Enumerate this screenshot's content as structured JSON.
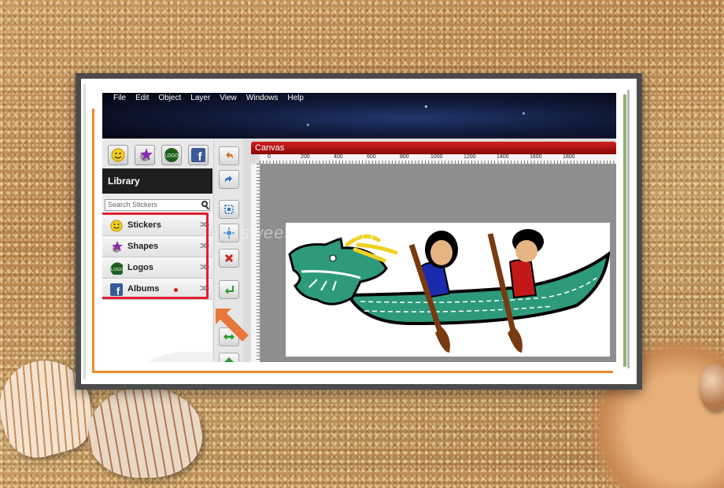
{
  "menu": [
    "File",
    "Edit",
    "Object",
    "Layer",
    "View",
    "Windows",
    "Help"
  ],
  "toolbar_icons": [
    "smiley-icon",
    "star-shape-icon",
    "logo-icon",
    "facebook-icon"
  ],
  "toolbar_icon_text": {
    "logo": "LOGO",
    "facebook": "f"
  },
  "library": {
    "title": "Library",
    "search_placeholder": "Search Stickers",
    "items": [
      {
        "label": "Stickers",
        "icon": "smiley-icon"
      },
      {
        "label": "Shapes",
        "icon": "star-shape-icon"
      },
      {
        "label": "Logos",
        "icon": "logo-icon"
      },
      {
        "label": "Albums",
        "icon": "facebook-icon",
        "has_dot": true
      }
    ],
    "chevron": ">>"
  },
  "vtools": [
    "undo",
    "redo",
    "select",
    "transform",
    "delete",
    "move-down",
    "swap",
    "move-up"
  ],
  "canvas": {
    "title": "Canvas",
    "ruler_ticks": [
      "0",
      "200",
      "400",
      "600",
      "800",
      "1000",
      "1200",
      "1400",
      "1600",
      "1800"
    ]
  },
  "watermark": "sweetmul.tistory.com",
  "colors": {
    "highlight": "#e02030",
    "canvas_bar": "#c01818",
    "dragon": "#2e9a7c"
  }
}
